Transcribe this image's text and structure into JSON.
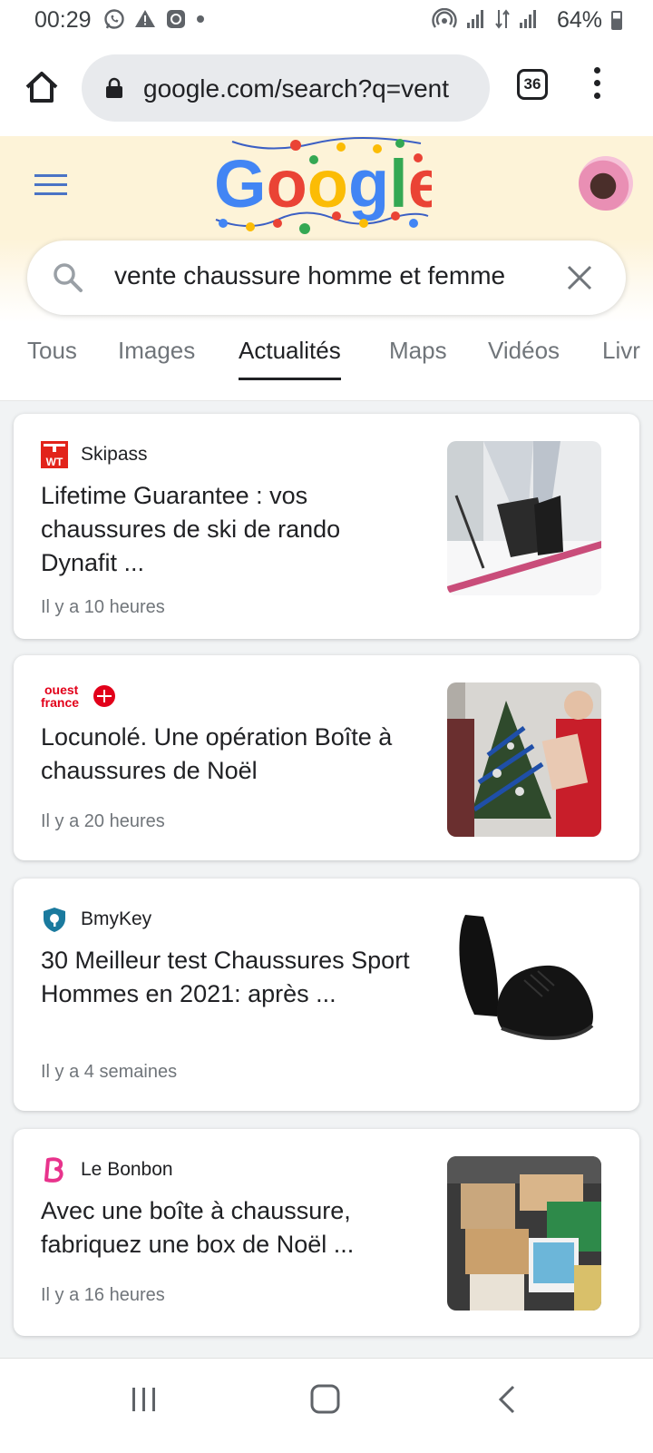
{
  "status_bar": {
    "time": "00:29",
    "battery": "64%"
  },
  "browser": {
    "url": "google.com/search?q=vent",
    "tab_count": "36"
  },
  "search": {
    "query": "vente chaussure homme et femme"
  },
  "tabs": [
    {
      "label": "Tous",
      "active": false
    },
    {
      "label": "Images",
      "active": false
    },
    {
      "label": "Actualités",
      "active": true
    },
    {
      "label": "Maps",
      "active": false
    },
    {
      "label": "Vidéos",
      "active": false
    },
    {
      "label": "Livr",
      "active": false
    }
  ],
  "results": [
    {
      "source": "Skipass",
      "headline": "Lifetime Guarantee : vos chaussures de ski de rando Dynafit ...",
      "time": "Il y a 10 heures",
      "source_icon": "skipass-logo-icon",
      "thumb": "ski-boots-image"
    },
    {
      "source": "",
      "headline": "Locunolé. Une opération Boîte à chaussures de Noël",
      "time": "Il y a 20 heures",
      "source_icon": "ouest-france-logo-icon",
      "thumb": "christmas-tree-image"
    },
    {
      "source": "BmyKey",
      "headline": "30 Meilleur test Chaussures Sport Hommes en 2021: après ...",
      "time": "Il y a 4 semaines",
      "source_icon": "bmykey-logo-icon",
      "thumb": "black-sneakers-image"
    },
    {
      "source": "Le Bonbon",
      "headline": "Avec une boîte à chaussure, fabriquez une box de Noël ...",
      "time": "Il y a 16 heures",
      "source_icon": "le-bonbon-logo-icon",
      "thumb": "gift-boxes-image"
    }
  ],
  "logos": {
    "ouest_france_line1": "ouest",
    "ouest_france_line2": "france",
    "skipass_mark": "WT"
  },
  "colors": {
    "google_blue": "#4285f4",
    "google_red": "#ea4335",
    "google_yellow": "#fbbc05",
    "google_green": "#34a853",
    "ouest_france_red": "#e2001a",
    "le_bonbon_pink": "#e8338c"
  }
}
